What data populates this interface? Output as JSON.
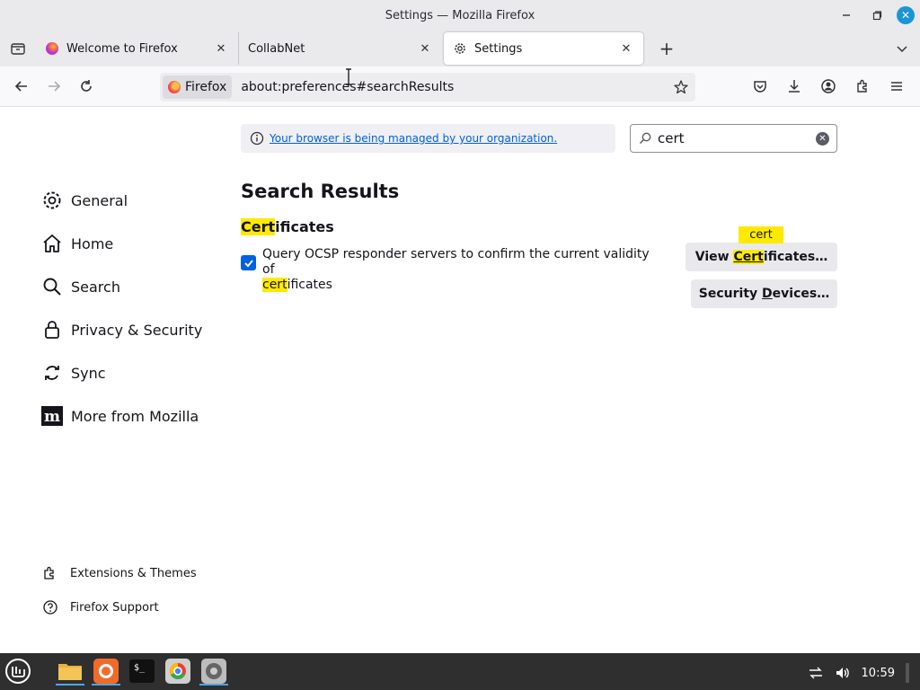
{
  "window": {
    "title": "Settings — Mozilla Firefox"
  },
  "tabs": [
    {
      "label": "Welcome to Firefox",
      "icon": "firefox-icon"
    },
    {
      "label": "CollabNet",
      "icon": "none"
    },
    {
      "label": "Settings",
      "icon": "gear-icon",
      "active": true
    }
  ],
  "urlbar": {
    "identity": "Firefox",
    "url": "about:preferences#searchResults"
  },
  "banner": {
    "text": "Your browser is being managed by your organization."
  },
  "search": {
    "value": "cert",
    "placeholder": "Find in Settings"
  },
  "sidebar": {
    "items": [
      {
        "label": "General",
        "icon": "gear-icon"
      },
      {
        "label": "Home",
        "icon": "home-icon"
      },
      {
        "label": "Search",
        "icon": "search-icon"
      },
      {
        "label": "Privacy & Security",
        "icon": "lock-icon"
      },
      {
        "label": "Sync",
        "icon": "sync-icon"
      },
      {
        "label": "More from Mozilla",
        "icon": "mozilla-icon"
      }
    ],
    "footer": [
      {
        "label": "Extensions & Themes",
        "icon": "puzzle-icon"
      },
      {
        "label": "Firefox Support",
        "icon": "help-icon"
      }
    ]
  },
  "results": {
    "title": "Search Results",
    "section_hl": "Cert",
    "section_rest": "ificates",
    "ocsp_line1": "Query OCSP responder servers to confirm the current validity of",
    "ocsp_hl": "cert",
    "ocsp_rest": "ificates",
    "ocsp_checked": true,
    "view_prefix": "View ",
    "view_hl": "Cert",
    "view_rest": "ificates…",
    "tooltip": "cert",
    "devices_prefix": "Security ",
    "devices_u": "D",
    "devices_rest": "evices…"
  },
  "taskbar": {
    "time": "10:59"
  },
  "colors": {
    "accent": "#0061e0",
    "highlight": "#ffe900"
  }
}
